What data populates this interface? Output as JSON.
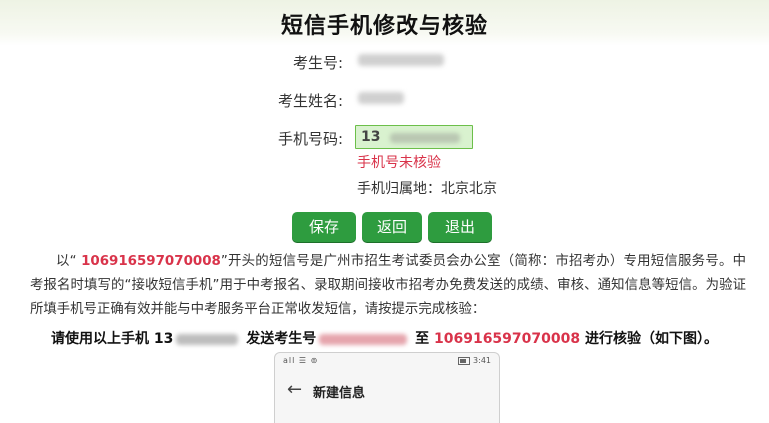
{
  "page": {
    "title": "短信手机修改与核验"
  },
  "form": {
    "exam_no_label": "考生号:",
    "name_label": "考生姓名:",
    "phone_label": "手机号码:",
    "phone_prefix": "13",
    "phone_status": "手机号未核验",
    "phone_location": "手机归属地：北京北京"
  },
  "buttons": {
    "save": "保存",
    "back": "返回",
    "exit": "退出"
  },
  "notice": {
    "p1_pre": "以“ ",
    "sms_number": "106916597070008",
    "p1_post": "”开头的短信号是广州市招生考试委员会办公室（简称：市招考办）专用短信服务号。中考报名时填写的“接收短信手机”用于中考报名、录取期间接收市招考办免费发送的成绩、审核、通知信息等短信。为验证所填手机号正确有效并能与中考服务平台正常收发短信，请按提示完成核验："
  },
  "instruction": {
    "part1": "请使用以上手机 13",
    "part2": " 发送考生号",
    "part3": " 至 ",
    "sms_number": "106916597070008",
    "part4": " 进行核验（如下图）。"
  },
  "phone_screenshot": {
    "status_left": "all ☰ ⊚",
    "status_right": "3:41",
    "header_title": "新建信息",
    "back_glyph": "←"
  },
  "colors": {
    "button_green": "#2e9c3f",
    "status_red": "#d9334a",
    "input_green_bg": "#d9f2cf",
    "title_band": "#eef3e4"
  }
}
